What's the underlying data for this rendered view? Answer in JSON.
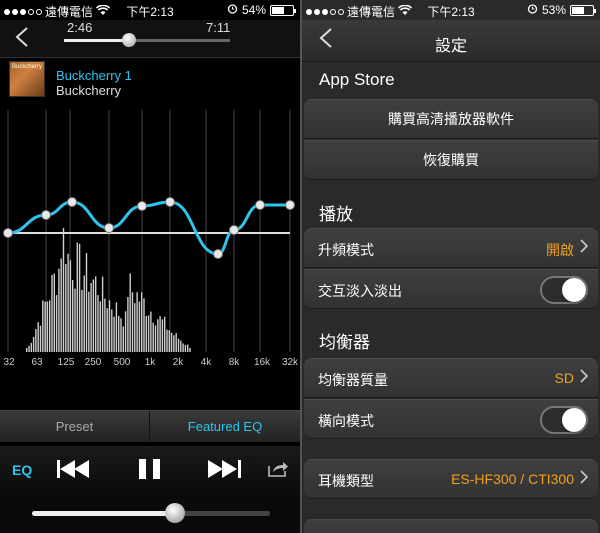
{
  "left": {
    "status": {
      "carrier": "遠傳電信",
      "time": "下午2:13",
      "battery": "54%",
      "battery_level": 0.54
    },
    "player": {
      "elapsed": "2:46",
      "total": "7:11",
      "progress": 0.39,
      "song_title": "Buckcherry 1",
      "artist": "Buckcherry",
      "album_art_text": "Buckcherry"
    },
    "eq": {
      "freq_labels": [
        "32",
        "63",
        "125",
        "250",
        "500",
        "1k",
        "2k",
        "4k",
        "8k",
        "16k",
        "32k"
      ],
      "curve_color": "#2fc4ee"
    },
    "tabs": {
      "preset": "Preset",
      "featured": "Featured EQ"
    },
    "controls": {
      "eq_label": "EQ",
      "volume": 0.6
    }
  },
  "right": {
    "status": {
      "carrier": "遠傳電信",
      "time": "下午2:13",
      "battery": "53%",
      "battery_level": 0.53
    },
    "nav": {
      "title": "設定"
    },
    "appstore": {
      "header": "App Store",
      "buy_label": "購買高清播放器軟件",
      "restore_label": "恢復購買"
    },
    "playback": {
      "header": "播放",
      "upsample_label": "升頻模式",
      "upsample_value": "開啟",
      "crossfade_label": "交互淡入淡出"
    },
    "equalizer": {
      "header": "均衡器",
      "quality_label": "均衡器質量",
      "quality_value": "SD",
      "landscape_label": "橫向模式"
    },
    "headphone": {
      "label": "耳機類型",
      "value": "ES-HF300 / CTI300"
    },
    "accent_color": "#f0a020"
  }
}
